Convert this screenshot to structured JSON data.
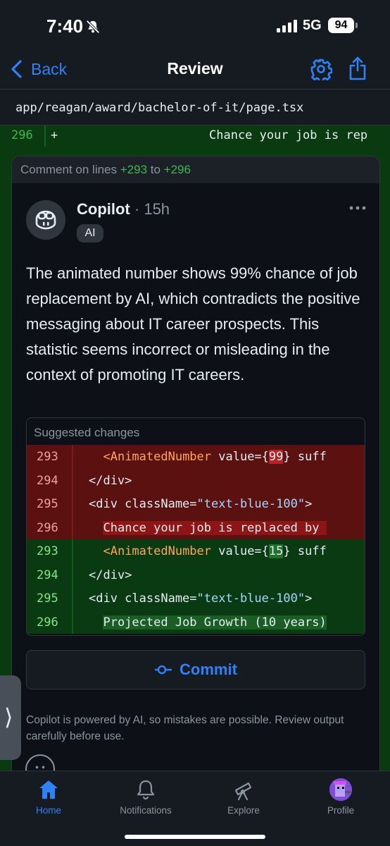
{
  "status_bar": {
    "time": "7:40",
    "network": "5G",
    "battery": "94"
  },
  "nav": {
    "back_label": "Back",
    "title": "Review"
  },
  "file_path": "app/reagan/award/bachelor-of-it/page.tsx",
  "context_line": {
    "number": "296",
    "marker": "+",
    "code": "Chance your job is rep"
  },
  "thread": {
    "header_prefix": "Comment on lines ",
    "start_line": "+293",
    "to_word": " to ",
    "end_line": "+296"
  },
  "comment": {
    "author": "Copilot",
    "separator": " · ",
    "time": "15h",
    "badge": "AI",
    "text": "The animated number shows 99% chance of job replacement by AI, which contradicts the positive messaging about IT career prospects. This statistic seems incorrect or misleading in the context of promoting IT careers."
  },
  "suggestion": {
    "title": "Suggested changes",
    "lines": [
      {
        "type": "del",
        "num": "293",
        "indent": "  ",
        "tag": "<AnimatedNumber",
        "pre": " value={",
        "hl": "99",
        "post": "} suff"
      },
      {
        "type": "del",
        "num": "294",
        "code": "</div>"
      },
      {
        "type": "del",
        "num": "295",
        "pre": "<div className=",
        "str": "\"text-blue-100\"",
        "post": ">"
      },
      {
        "type": "del",
        "num": "296",
        "indent": "  ",
        "full_hl": "Chance your job is replaced by "
      },
      {
        "type": "add",
        "num": "293",
        "indent": "  ",
        "tag": "<AnimatedNumber",
        "pre": " value={",
        "hl": "15",
        "post": "} suff"
      },
      {
        "type": "add",
        "num": "294",
        "code": "</div>"
      },
      {
        "type": "add",
        "num": "295",
        "pre": "<div className=",
        "str": "\"text-blue-100\"",
        "post": ">"
      },
      {
        "type": "add",
        "num": "296",
        "indent": "  ",
        "full_hl": "Projected Job Growth (10 years)"
      }
    ]
  },
  "commit_label": "Commit",
  "disclaimer": "Copilot is powered by AI, so mistakes are possible. Review output carefully before use.",
  "side_handle_glyph": "⟩",
  "tabs": [
    {
      "label": "Home",
      "icon": "home-icon",
      "active": true
    },
    {
      "label": "Notifications",
      "icon": "bell-icon",
      "active": false
    },
    {
      "label": "Explore",
      "icon": "telescope-icon",
      "active": false
    },
    {
      "label": "Profile",
      "icon": "avatar-icon",
      "active": false
    }
  ],
  "colors": {
    "accent": "#2f81f7",
    "addition": "#3fb950",
    "deletion_bg": "#5c1111",
    "addition_bg": "#0a3a12"
  }
}
